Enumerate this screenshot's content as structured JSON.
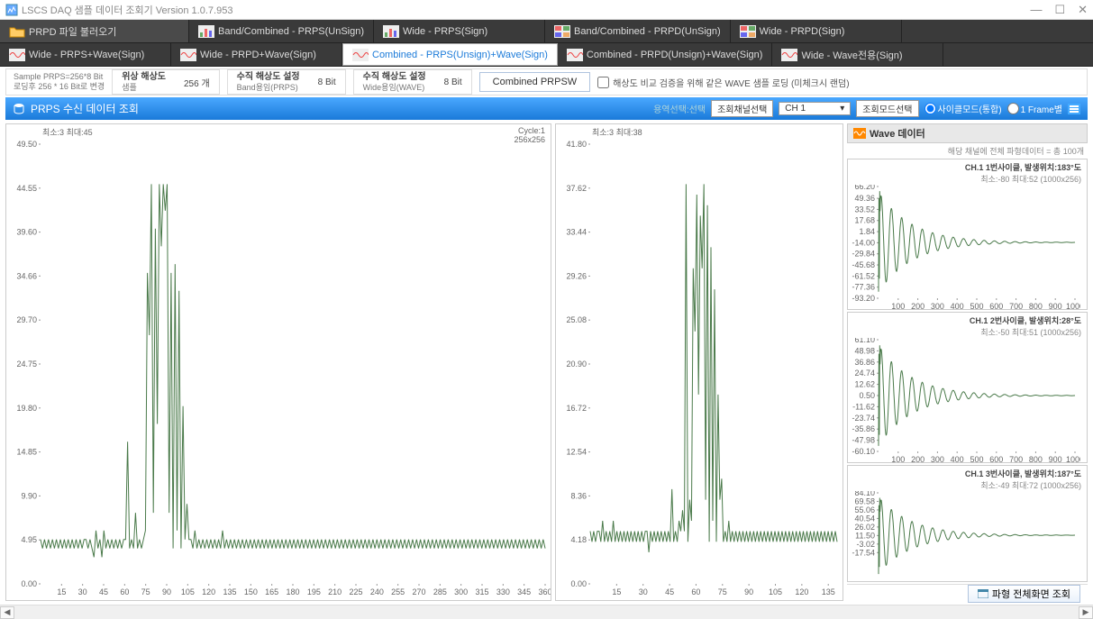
{
  "window": {
    "title": "LSCS DAQ 샘플 데이터 조회기 Version 1.0.7.953"
  },
  "toolbar_row1": [
    {
      "label": "PRPD 파일 불러오기",
      "icon": "folder",
      "load": true
    },
    {
      "label": "Band/Combined - PRPS(UnSign)",
      "icon": "chart"
    },
    {
      "label": "Wide - PRPS(Sign)",
      "icon": "chart"
    },
    {
      "label": "Band/Combined - PRPD(UnSign)",
      "icon": "grid"
    },
    {
      "label": "Wide - PRPD(Sign)",
      "icon": "grid"
    }
  ],
  "toolbar_row2": [
    {
      "label": "Wide - PRPS+Wave(Sign)",
      "icon": "wave"
    },
    {
      "label": "Wide - PRPD+Wave(Sign)",
      "icon": "wave"
    },
    {
      "label": "Combined - PRPS(Unsign)+Wave(Sign)",
      "icon": "wave",
      "active": true
    },
    {
      "label": "Combined - PRPD(Unsign)+Wave(Sign)",
      "icon": "wave"
    },
    {
      "label": "Wide - Wave전용(Sign)",
      "icon": "wave"
    }
  ],
  "options": {
    "sample_info1": "Sample PRPS=256*8 Bit",
    "sample_info2": "로딩후 256 * 16 Bit로 변경",
    "phase_label": "위상 해상도",
    "phase_sub": "샘플",
    "phase_val": "256 개",
    "vres_label": "수직 해상도 설정",
    "vres_sub": "Band용임(PRPS)",
    "vres_val": "8 Bit",
    "vres2_label": "수직 해상도 설정",
    "vres2_sub": "Wide용임(WAVE)",
    "vres2_val": "8 Bit",
    "btn": "Combined PRPSW",
    "checkbox": "해상도 비교 검증을 위해 같은 WAVE 샘플 로딩 (미체크시 랜덤)"
  },
  "section": {
    "title": "PRPS 수신 데이터 조회",
    "ch_label": "조회채널선택",
    "ch_val": "CH 1",
    "mode_label": "조회모드선택",
    "radio1": "사이클모드(통합)",
    "radio2": "1 Frame별"
  },
  "chart_data": [
    {
      "type": "line",
      "panel": "large",
      "stats": "최소:3 최대:45",
      "cycle": "Cycle:1",
      "size": "256x256",
      "ylim": [
        0,
        49.5
      ],
      "yticks": [
        0.0,
        4.95,
        9.9,
        14.85,
        19.8,
        24.75,
        29.7,
        34.66,
        39.6,
        44.55,
        49.5
      ],
      "xlim": [
        0,
        360
      ],
      "xticks": [
        15,
        30,
        45,
        60,
        75,
        90,
        105,
        120,
        135,
        150,
        165,
        180,
        195,
        210,
        225,
        240,
        255,
        270,
        285,
        300,
        315,
        330,
        345,
        360
      ],
      "values": [
        5,
        4,
        5,
        4,
        5,
        4,
        5,
        4,
        5,
        4,
        5,
        4,
        5,
        4,
        5,
        4,
        5,
        4,
        5,
        4,
        5,
        4,
        5,
        5,
        4,
        5,
        4,
        3,
        6,
        4,
        5,
        3,
        6,
        4,
        5,
        4,
        5,
        4,
        5,
        4,
        5,
        4,
        5,
        5,
        16,
        4,
        5,
        4,
        8,
        4,
        5,
        4,
        5,
        6,
        35,
        28,
        45,
        8,
        40,
        18,
        45,
        38,
        45,
        42,
        45,
        8,
        35,
        4,
        36,
        6,
        33,
        4,
        20,
        5,
        9,
        5,
        5,
        4,
        6,
        4,
        5,
        4,
        5,
        4,
        5,
        4,
        5,
        4,
        5,
        4,
        5,
        4,
        6,
        4,
        5,
        4,
        5,
        4,
        5,
        4,
        5,
        4,
        5,
        4,
        5,
        4,
        5,
        4,
        5,
        4,
        5,
        4,
        5,
        4,
        5,
        4,
        5,
        4,
        5,
        4,
        5,
        4,
        5,
        4,
        5,
        4,
        5,
        4,
        5,
        4,
        5,
        4,
        5,
        4,
        5,
        4,
        5,
        4,
        5,
        4,
        5,
        4,
        5,
        4,
        5,
        4,
        5,
        4,
        5,
        4,
        5,
        4,
        5,
        4,
        5,
        4,
        5,
        4,
        5,
        4,
        5,
        4,
        5,
        4,
        5,
        4,
        5,
        4,
        5,
        4,
        5,
        4,
        5,
        4,
        5,
        4,
        5,
        4,
        5,
        4,
        5,
        4,
        5,
        4,
        5,
        4,
        5,
        4,
        5,
        4,
        5,
        4,
        5,
        4,
        5,
        4,
        5,
        4,
        5,
        4,
        5,
        4,
        5,
        4,
        5,
        4,
        5,
        4,
        5,
        4,
        5,
        4,
        5,
        4,
        5,
        4,
        5,
        4,
        5,
        4,
        5,
        4,
        5,
        4,
        5,
        4,
        5,
        4,
        5,
        4,
        5,
        4,
        5,
        4,
        5,
        4,
        5,
        4,
        5,
        4,
        5,
        4,
        5,
        4,
        5,
        4,
        5,
        4,
        5,
        4,
        5,
        4,
        5,
        4,
        5,
        4
      ]
    },
    {
      "type": "line",
      "panel": "med",
      "stats": "최소:3 최대:38",
      "ylim": [
        0,
        41.8
      ],
      "yticks": [
        0.0,
        4.18,
        8.36,
        12.54,
        16.72,
        20.9,
        25.08,
        29.26,
        33.44,
        37.62,
        41.8
      ],
      "xlim": [
        0,
        140
      ],
      "xticks": [
        15,
        30,
        45,
        60,
        75,
        90,
        105,
        120,
        135
      ],
      "values": [
        5,
        4,
        5,
        4,
        5,
        5,
        4,
        6,
        4,
        5,
        4,
        5,
        4,
        6,
        4,
        5,
        4,
        5,
        4,
        5,
        4,
        5,
        4,
        5,
        4,
        5,
        4,
        5,
        4,
        5,
        4,
        5,
        5,
        3,
        5,
        4,
        5,
        4,
        5,
        4,
        5,
        4,
        5,
        4,
        5,
        4,
        9,
        4,
        5,
        4,
        6,
        5,
        7,
        5,
        38,
        4,
        8,
        6,
        30,
        24,
        37,
        18,
        35,
        30,
        38,
        8,
        36,
        4,
        32,
        6,
        28,
        4,
        18,
        8,
        10,
        4,
        5,
        4,
        6,
        4,
        5,
        4,
        5,
        4,
        5,
        4,
        5,
        4,
        5,
        4,
        5,
        4,
        5,
        4,
        5,
        4,
        5,
        4,
        5,
        4,
        5,
        4,
        5,
        4,
        5,
        4,
        5,
        4,
        5,
        4,
        5,
        4,
        5,
        4,
        5,
        4,
        5,
        4,
        5,
        4,
        5,
        4,
        5,
        4,
        5,
        4,
        5,
        4,
        5,
        4,
        5,
        4,
        5,
        4,
        5,
        4,
        5,
        4,
        5,
        4
      ]
    },
    {
      "type": "line",
      "panel": "wave1",
      "title": "CH.1 1번사이클, 발생위치:183°도",
      "stats": "최소:-80 최대:52 (1000x256)",
      "ylim": [
        -93.2,
        66.2
      ],
      "yticks": [
        -93.2,
        -77.36,
        -61.52,
        -45.68,
        -29.84,
        -14.0,
        1.84,
        17.68,
        33.52,
        49.36,
        66.2
      ],
      "xlim": [
        0,
        1000
      ],
      "xticks": [
        100,
        200,
        300,
        400,
        500,
        600,
        700,
        800,
        900,
        1000
      ]
    },
    {
      "type": "line",
      "panel": "wave2",
      "title": "CH.1 2번사이클, 발생위치:28°도",
      "stats": "최소:-50 최대:51 (1000x256)",
      "ylim": [
        -60.1,
        61.1
      ],
      "yticks": [
        -60.1,
        -47.98,
        -35.86,
        -23.74,
        -11.62,
        0.5,
        12.62,
        24.74,
        36.86,
        48.98,
        61.1
      ],
      "xlim": [
        0,
        1000
      ],
      "xticks": [
        100,
        200,
        300,
        400,
        500,
        600,
        700,
        800,
        900,
        1000
      ]
    },
    {
      "type": "line",
      "panel": "wave3",
      "title": "CH.1 3번사이클, 발생위치:187°도",
      "stats": "최소:-49 최대:72 (1000x256)",
      "ylim": [
        -60,
        84.1
      ],
      "yticks": [
        -17.54,
        -3.02,
        11.5,
        26.02,
        40.54,
        55.06,
        69.58,
        84.1
      ],
      "xlim": [
        0,
        1000
      ],
      "xticks": []
    }
  ],
  "wave_header": "Wave 데이터",
  "wave_sub": "해당 채널에 전체 파형데이터 = 총 100개",
  "footer_btn": "파형 전체화면 조회"
}
